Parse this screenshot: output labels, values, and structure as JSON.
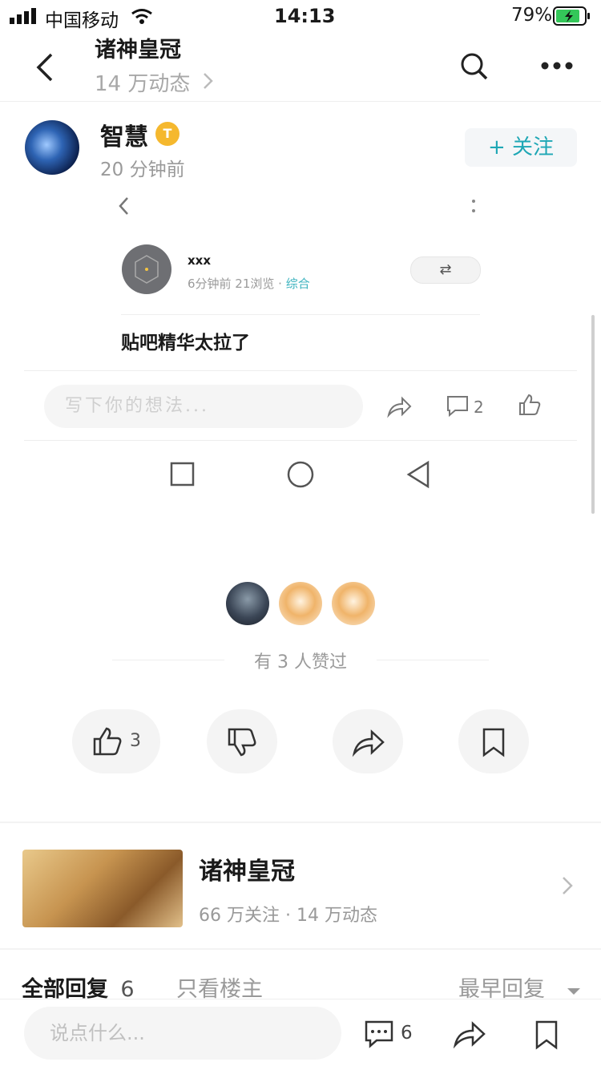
{
  "status_bar": {
    "carrier": "中国移动",
    "time": "14:13",
    "battery": "79%"
  },
  "nav": {
    "title": "诸神皇冠",
    "subtitle": "14 万动态"
  },
  "author": {
    "name": "智慧",
    "badge": "T",
    "time": "20 分钟前",
    "follow_label": "+ 关注"
  },
  "embedded": {
    "name": "xxx",
    "meta": "6分钟前  21浏览 · ",
    "category": "综合",
    "text": "贴吧精华太拉了",
    "comment_placeholder": "写下你的想法...",
    "comment_count": "2"
  },
  "likes": {
    "text": "有 3 人赞过",
    "like_count": "3"
  },
  "forum": {
    "name": "诸神皇冠",
    "stats": "66 万关注 · 14 万动态"
  },
  "replies": {
    "all_label": "全部回复",
    "all_count": "6",
    "op_only": "只看楼主",
    "sort": "最早回复"
  },
  "bottom": {
    "placeholder": "说点什么...",
    "comment_count": "6"
  },
  "colors": {
    "accent": "#1ea7b5",
    "badge": "#f5b82e"
  }
}
